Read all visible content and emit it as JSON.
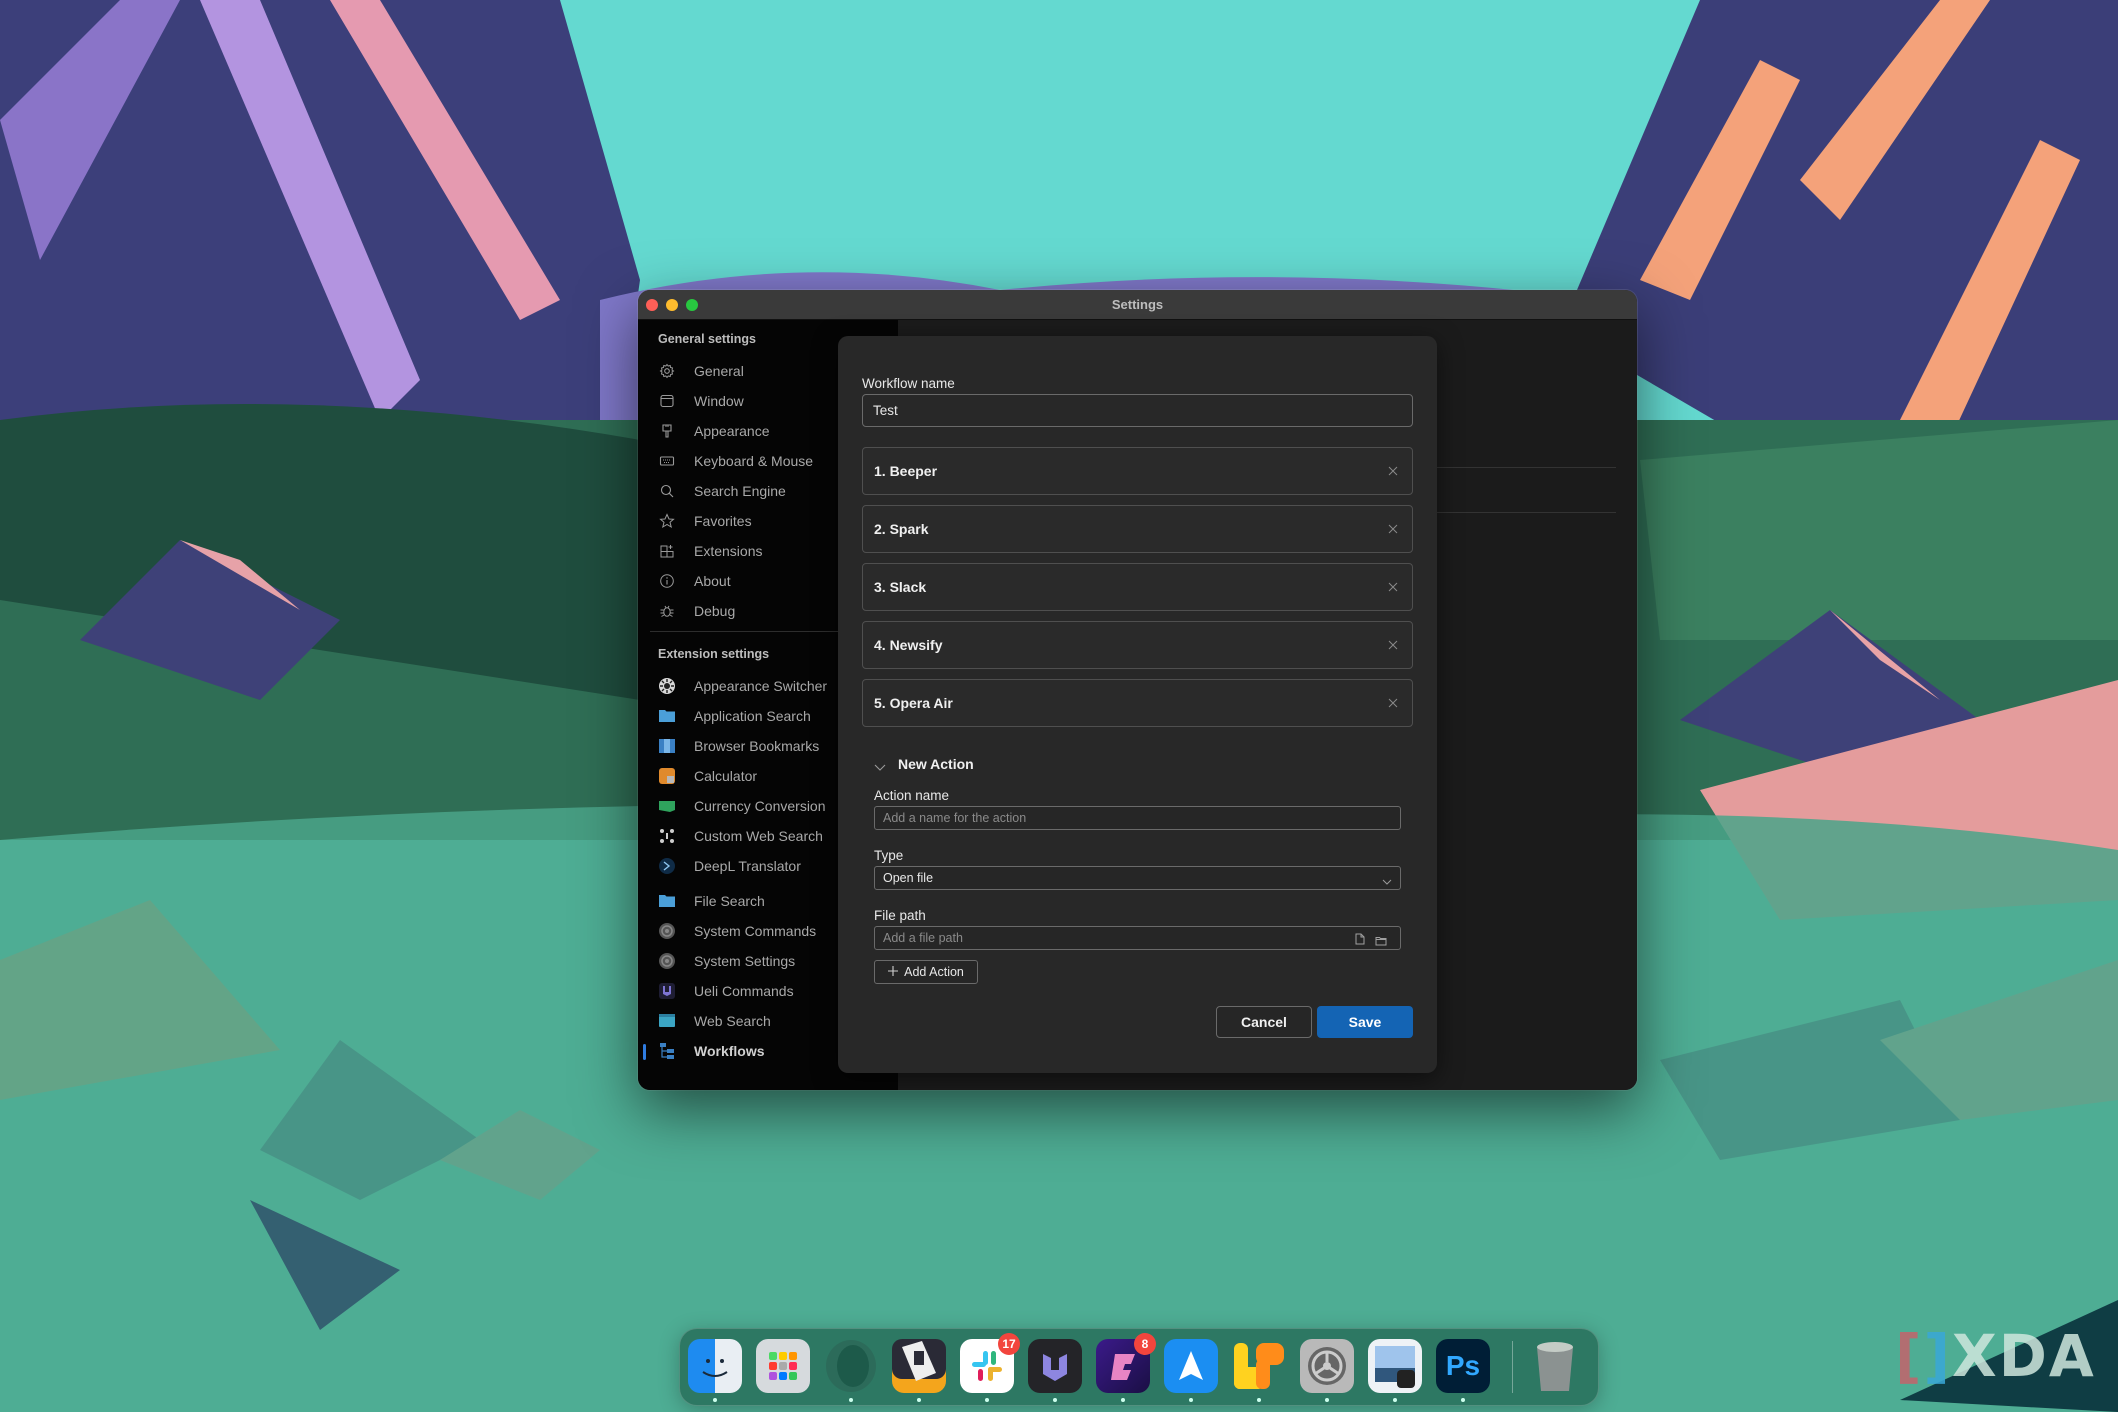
{
  "window": {
    "title": "Settings"
  },
  "sidebar": {
    "general_heading": "General settings",
    "general_items": [
      {
        "label": "General",
        "icon": "gear-icon"
      },
      {
        "label": "Window",
        "icon": "window-icon"
      },
      {
        "label": "Appearance",
        "icon": "paintbrush-icon"
      },
      {
        "label": "Keyboard & Mouse",
        "icon": "keyboard-icon"
      },
      {
        "label": "Search Engine",
        "icon": "search-icon"
      },
      {
        "label": "Favorites",
        "icon": "star-icon"
      },
      {
        "label": "Extensions",
        "icon": "extensions-icon"
      },
      {
        "label": "About",
        "icon": "info-icon"
      },
      {
        "label": "Debug",
        "icon": "bug-icon"
      }
    ],
    "extension_heading": "Extension settings",
    "extension_items": [
      {
        "label": "Appearance Switcher",
        "icon": "appearance-switcher-icon"
      },
      {
        "label": "Application Search",
        "icon": "folder-icon"
      },
      {
        "label": "Browser Bookmarks",
        "icon": "bookmarks-icon"
      },
      {
        "label": "Calculator",
        "icon": "calculator-icon"
      },
      {
        "label": "Currency Conversion",
        "icon": "currency-icon"
      },
      {
        "label": "Custom Web Search",
        "icon": "custom-web-search-icon"
      },
      {
        "label": "DeepL Translator",
        "icon": "deepl-icon"
      },
      {
        "label": "File Search",
        "icon": "folder-icon"
      },
      {
        "label": "System Commands",
        "icon": "system-commands-icon"
      },
      {
        "label": "System Settings",
        "icon": "system-settings-icon"
      },
      {
        "label": "Ueli Commands",
        "icon": "ueli-icon"
      },
      {
        "label": "Web Search",
        "icon": "web-search-icon"
      },
      {
        "label": "Workflows",
        "icon": "workflows-icon",
        "active": true
      }
    ]
  },
  "modal": {
    "workflow_name_label": "Workflow name",
    "workflow_name_value": "Test",
    "actions": [
      {
        "label": "1. Beeper"
      },
      {
        "label": "2. Spark"
      },
      {
        "label": "3. Slack"
      },
      {
        "label": "4. Newsify"
      },
      {
        "label": "5. Opera Air"
      }
    ],
    "new_action": {
      "header": "New Action",
      "action_name_label": "Action name",
      "action_name_placeholder": "Add a name for the action",
      "type_label": "Type",
      "type_value": "Open file",
      "file_path_label": "File path",
      "file_path_placeholder": "Add a file path",
      "add_action_label": "Add Action"
    },
    "cancel_label": "Cancel",
    "save_label": "Save",
    "accent_color": "#1464b4"
  },
  "dock": {
    "apps": [
      {
        "name": "Finder"
      },
      {
        "name": "Launchpad"
      },
      {
        "name": "Opera Air"
      },
      {
        "name": "Newsify"
      },
      {
        "name": "Slack",
        "badge": "17"
      },
      {
        "name": "Ueli"
      },
      {
        "name": "Beeper",
        "badge": "8"
      },
      {
        "name": "Spark"
      },
      {
        "name": "Flow"
      },
      {
        "name": "System Settings"
      },
      {
        "name": "Preview"
      },
      {
        "name": "Photoshop",
        "text": "Ps"
      },
      {
        "name": "Trash"
      }
    ]
  },
  "watermark": {
    "text": "XDA"
  }
}
